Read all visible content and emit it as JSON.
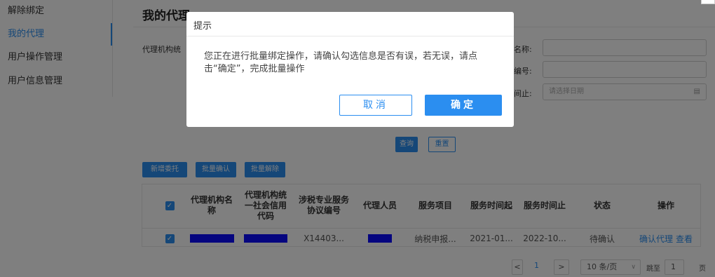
{
  "sidebar": {
    "items": [
      {
        "label": "解除绑定"
      },
      {
        "label": "我的代理"
      },
      {
        "label": "用户操作管理"
      },
      {
        "label": "用户信息管理"
      }
    ]
  },
  "main": {
    "title": "我的代理",
    "filters": {
      "agency_label": "代理机构统",
      "name_label": "名称:",
      "number_label": "编号:",
      "end_label": "间止:",
      "date_placeholder": "请选择日期"
    },
    "query_label": "查询",
    "reset_label": "重置",
    "actions": {
      "new_label": "新增委托",
      "batch_confirm_label": "批量确认",
      "batch_remove_label": "批量解除"
    },
    "table": {
      "headers": [
        "代理机构名称",
        "代理机构统一社会信用代码",
        "涉税专业服务协议编号",
        "代理人员",
        "服务项目",
        "服务时间起",
        "服务时间止",
        "状态",
        "操作"
      ],
      "row": {
        "agreement_no": "X14403...",
        "service_item": "纳税申报...",
        "start": "2021-01...",
        "end": "2022-10...",
        "status": "待确认",
        "op_confirm": "确认代理",
        "op_view": "查看"
      }
    },
    "pager": {
      "prev": "<",
      "page": "1",
      "next": ">",
      "page_size": "10 条/页",
      "jump_label": "跳至",
      "jump_value": "1",
      "page_suffix": "页"
    }
  },
  "dialog": {
    "title": "提示",
    "message": "您正在进行批量绑定操作，请确认勾选信息是否有误，若无误，请点击“确定”，完成批量操作",
    "cancel_label": "取消",
    "ok_label": "确定"
  },
  "colors": {
    "accent": "#2b8ef0",
    "redacted": "#0b0bff"
  }
}
